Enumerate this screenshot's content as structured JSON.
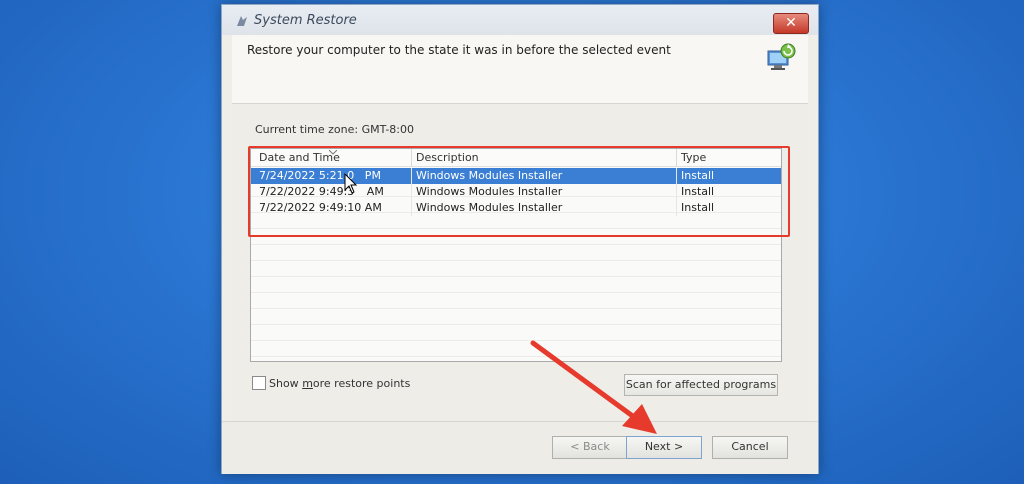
{
  "window": {
    "title": "System Restore",
    "close_glyph": "✕",
    "icon": "system-restore-icon"
  },
  "header": {
    "text": "Restore your computer to the state it was in before the selected event",
    "icon": "restore-computer-icon"
  },
  "timezone": "Current time zone: GMT-8:00",
  "list": {
    "columns": [
      "Date and Time",
      "Description",
      "Type"
    ],
    "rows": [
      {
        "date": "7/24/2022 5:21:0",
        "date_tail": " PM",
        "description": "Windows Modules Installer",
        "type": "Install",
        "selected": true
      },
      {
        "date": "7/22/2022 9:49:3",
        "date_tail": " AM",
        "description": "Windows Modules Installer",
        "type": "Install",
        "selected": false
      },
      {
        "date": "7/22/2022 9:49:10 AM",
        "date_tail": "",
        "description": "Windows Modules Installer",
        "type": "Install",
        "selected": false
      }
    ]
  },
  "checkbox": {
    "label_pre": "Show ",
    "label_mnemonic": "m",
    "label_post": "ore restore points",
    "checked": false
  },
  "buttons": {
    "scan": "Scan for affected programs",
    "back": "< Back",
    "next": "Next >",
    "cancel": "Cancel"
  },
  "colors": {
    "accent_selection": "#3b7fd4",
    "highlight_box": "#e53a2c",
    "annotation_arrow": "#e53a2c",
    "desktop": "#2a76d2"
  }
}
